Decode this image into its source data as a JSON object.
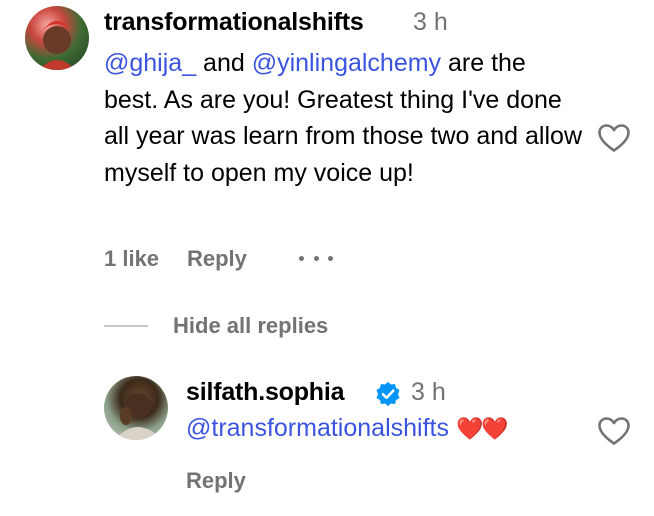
{
  "comments": [
    {
      "username": "transformationalshifts",
      "time": "3 h",
      "mention_a": "@ghija_",
      "text_a": " and ",
      "mention_b": "@yinlingalchemy",
      "text_b": " are the best. As are you! Greatest thing I've done all year was learn from those two and allow myself to open my voice up!",
      "likes": "1 like",
      "reply_label": "Reply",
      "more_icon": "more-horizontal-icon",
      "like_icon": "heart-outline-icon"
    }
  ],
  "replies_toggle": {
    "label": "Hide all replies"
  },
  "replies": [
    {
      "username": "silfath.sophia",
      "verified_icon": "verified-badge-icon",
      "time": "3 h",
      "mention": "@transformationalshifts",
      "emoji": "❤️❤️",
      "reply_label": "Reply",
      "like_icon": "heart-outline-icon"
    }
  ],
  "colors": {
    "mention": "#3b54e0",
    "secondary_text": "#737373",
    "verified": "#0095f6",
    "divider": "#c7c7c7"
  }
}
